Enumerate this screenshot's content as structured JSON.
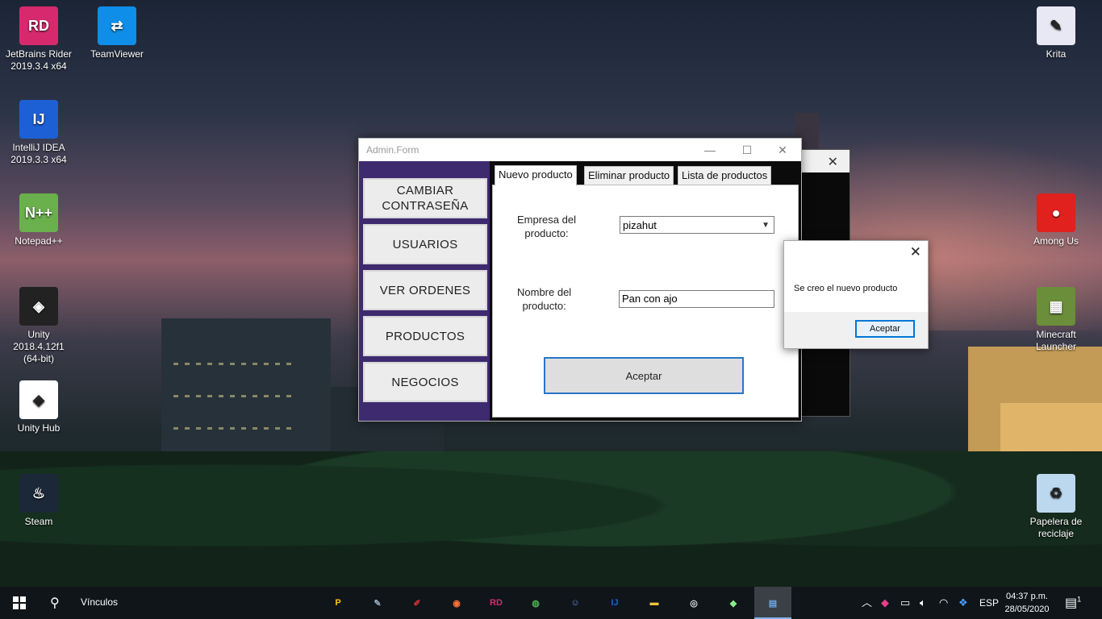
{
  "desktop": {
    "icons_left": [
      {
        "label": "JetBrains Rider\n2019.3.4 x64",
        "icon": "rider-icon",
        "glyph": "RD",
        "color": "#d72a6e"
      },
      {
        "label": "TeamViewer",
        "icon": "teamviewer-icon",
        "glyph": "⇄",
        "color": "#0e8ee9"
      },
      {
        "label": "IntelliJ IDEA\n2019.3.3 x64",
        "icon": "intellij-icon",
        "glyph": "IJ",
        "color": "#1d60d6"
      },
      {
        "label": "Notepad++",
        "icon": "notepadpp-icon",
        "glyph": "N++",
        "color": "#6ab04c"
      },
      {
        "label": "Unity 2018.4.12f1\n(64-bit)",
        "icon": "unity-icon",
        "glyph": "◈",
        "color": "#222222"
      },
      {
        "label": "Unity Hub",
        "icon": "unity-hub-icon",
        "glyph": "◈",
        "color": "#ffffff"
      },
      {
        "label": "Steam",
        "icon": "steam-icon",
        "glyph": "♨",
        "color": "#1b2838"
      }
    ],
    "icons_right": [
      {
        "label": "Krita",
        "icon": "krita-icon",
        "glyph": "✎",
        "color": "#e8e8f5"
      },
      {
        "label": "Among Us",
        "icon": "among-us-icon",
        "glyph": "●",
        "color": "#e0211d"
      },
      {
        "label": "Minecraft\nLauncher",
        "icon": "minecraft-icon",
        "glyph": "▦",
        "color": "#6b8e3a"
      },
      {
        "label": "Papelera de\nreciclaje",
        "icon": "recycle-bin-icon",
        "glyph": "♻",
        "color": "#bcd8ef"
      }
    ]
  },
  "admin_form": {
    "title": "Admin.Form",
    "sidebar": {
      "cambiar": "CAMBIAR\nCONTRASEÑA",
      "usuarios": "USUARIOS",
      "ordenes": "VER ORDENES",
      "productos": "PRODUCTOS",
      "negocios": "NEGOCIOS"
    },
    "tabs": {
      "nuevo": "Nuevo producto",
      "eliminar": "Eliminar producto",
      "lista": "Lista de productos"
    },
    "form": {
      "empresa_label": "Empresa del\nproducto:",
      "empresa_value": "pizahut",
      "nombre_label": "Nombre del\nproducto:",
      "nombre_value": "Pan con ajo",
      "aceptar": "Aceptar"
    }
  },
  "message_box": {
    "text": "Se creo el nuevo producto",
    "button": "Aceptar"
  },
  "taskbar": {
    "search_label": "Vínculos",
    "language": "ESP",
    "time": "04:37 p.m.",
    "date": "28/05/2020",
    "notification_count": "1",
    "apps": [
      {
        "icon": "plex-icon",
        "glyph": "P",
        "color": "#f5c518"
      },
      {
        "icon": "krita-icon",
        "glyph": "✎",
        "color": "#9ab"
      },
      {
        "icon": "pencil-icon",
        "glyph": "✐",
        "color": "#c33"
      },
      {
        "icon": "firefox-icon",
        "glyph": "◉",
        "color": "#ff7139"
      },
      {
        "icon": "rider-icon",
        "glyph": "RD",
        "color": "#d72a6e"
      },
      {
        "icon": "chrome-icon",
        "glyph": "◍",
        "color": "#4caf50"
      },
      {
        "icon": "discord-icon",
        "glyph": "☺",
        "color": "#7289da"
      },
      {
        "icon": "intellij-icon",
        "glyph": "IJ",
        "color": "#1d60d6"
      },
      {
        "icon": "file-explorer-icon",
        "glyph": "▬",
        "color": "#f3c33a"
      },
      {
        "icon": "media-icon",
        "glyph": "◎",
        "color": "#ddd"
      },
      {
        "icon": "git-icon",
        "glyph": "◆",
        "color": "#8e8"
      },
      {
        "icon": "app-window-icon",
        "glyph": "▤",
        "color": "#6aa8e8"
      }
    ]
  }
}
